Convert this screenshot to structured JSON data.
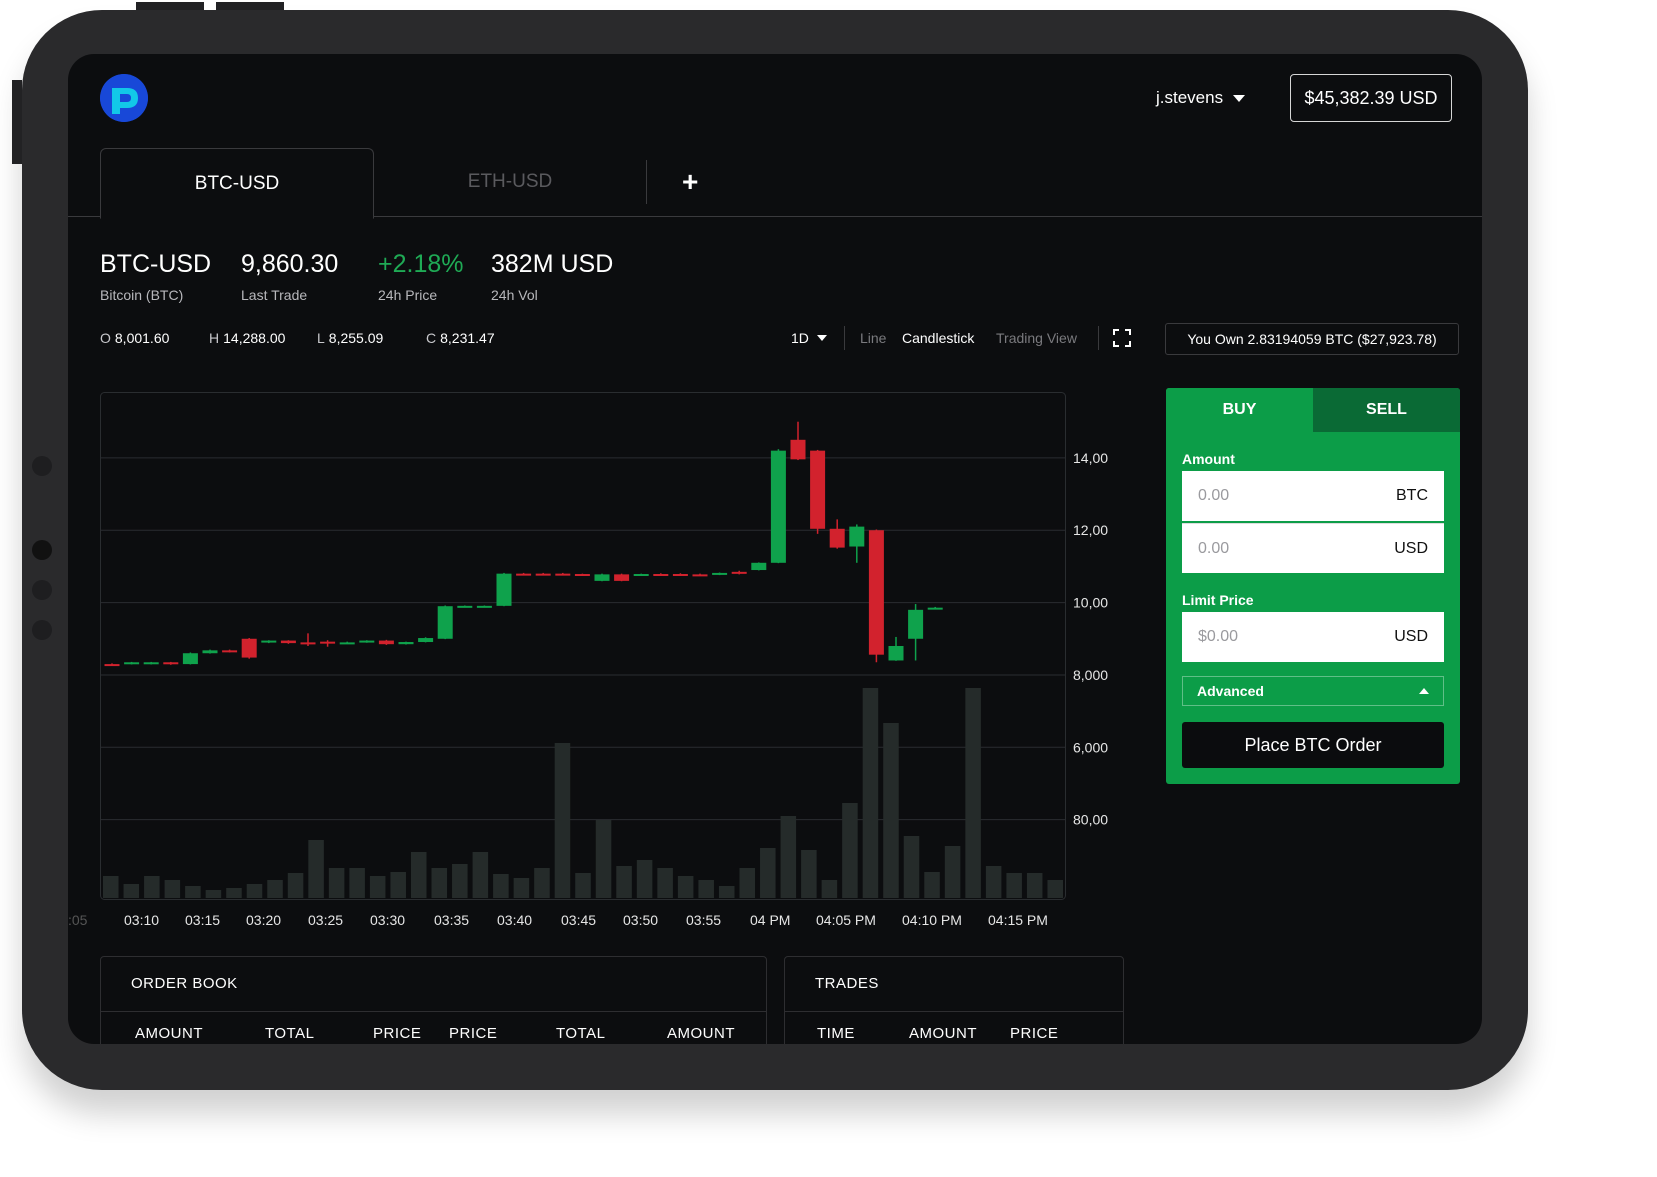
{
  "header": {
    "username": "j.stevens",
    "balance": "$45,382.39 USD"
  },
  "tabs": [
    {
      "label": "BTC-USD",
      "active": true
    },
    {
      "label": "ETH-USD",
      "active": false
    }
  ],
  "add_tab": "+",
  "stats": {
    "pair": "BTC-USD",
    "pair_sub": "Bitcoin (BTC)",
    "last_trade": "9,860.30",
    "last_trade_label": "Last Trade",
    "change": "+2.18%",
    "change_label": "24h Price",
    "volume": "382M USD",
    "volume_label": "24h Vol"
  },
  "ohlc": {
    "o_label": "O",
    "o": "8,001.60",
    "h_label": "H",
    "h": "14,288.00",
    "l_label": "L",
    "l": "8,255.09",
    "c_label": "C",
    "c": "8,231.47"
  },
  "controls": {
    "interval": "1D",
    "line": "Line",
    "candlestick": "Candlestick",
    "trading_view": "Trading View"
  },
  "owned": "You Own 2.83194059 BTC ($27,923.78)",
  "order_panel": {
    "buy": "BUY",
    "sell": "SELL",
    "amount_label": "Amount",
    "amount_btc_placeholder": "0.00",
    "amount_btc_unit": "BTC",
    "amount_usd_placeholder": "0.00",
    "amount_usd_unit": "USD",
    "limit_label": "Limit Price",
    "limit_placeholder": "$0.00",
    "limit_unit": "USD",
    "advanced": "Advanced",
    "place_order": "Place BTC Order"
  },
  "order_book": {
    "title": "ORDER BOOK",
    "columns": [
      "AMOUNT",
      "TOTAL",
      "PRICE",
      "PRICE",
      "TOTAL",
      "AMOUNT"
    ]
  },
  "trades": {
    "title": "TRADES",
    "columns": [
      "TIME",
      "AMOUNT",
      "PRICE"
    ]
  },
  "colors": {
    "up": "#0fa24c",
    "down": "#d2222d",
    "panel": "#0c9d48",
    "volume": "#252b2a"
  },
  "chart_data": {
    "type": "candlestick",
    "y_ticks": [
      "14,000.00",
      "12,000.0",
      "10,000.00",
      "8,000.00",
      "6,000.00",
      "80,000"
    ],
    "ylim": [
      2000,
      15600
    ],
    "x_ticks": [
      ":05",
      "03:10",
      "03:15",
      "03:20",
      "03:25",
      "03:30",
      "03:35",
      "03:40",
      "03:45",
      "03:50",
      "03:55",
      "04 PM",
      "04:05 PM",
      "04:10 PM",
      "04:15 PM"
    ],
    "candles": [
      {
        "o": 8300,
        "h": 8320,
        "l": 8280,
        "c": 8290
      },
      {
        "o": 8300,
        "h": 8360,
        "l": 8290,
        "c": 8350
      },
      {
        "o": 8300,
        "h": 8360,
        "l": 8290,
        "c": 8350
      },
      {
        "o": 8350,
        "h": 8360,
        "l": 8280,
        "c": 8300
      },
      {
        "o": 8300,
        "h": 8620,
        "l": 8290,
        "c": 8600
      },
      {
        "o": 8600,
        "h": 8700,
        "l": 8590,
        "c": 8680
      },
      {
        "o": 8680,
        "h": 8700,
        "l": 8620,
        "c": 8640
      },
      {
        "o": 9000,
        "h": 9020,
        "l": 8450,
        "c": 8480
      },
      {
        "o": 8900,
        "h": 8960,
        "l": 8880,
        "c": 8950
      },
      {
        "o": 8950,
        "h": 8960,
        "l": 8860,
        "c": 8880
      },
      {
        "o": 8900,
        "h": 9150,
        "l": 8800,
        "c": 8880
      },
      {
        "o": 8920,
        "h": 8960,
        "l": 8780,
        "c": 8870
      },
      {
        "o": 8880,
        "h": 8920,
        "l": 8860,
        "c": 8900
      },
      {
        "o": 8900,
        "h": 8960,
        "l": 8890,
        "c": 8950
      },
      {
        "o": 8950,
        "h": 8970,
        "l": 8830,
        "c": 8850
      },
      {
        "o": 8850,
        "h": 8920,
        "l": 8840,
        "c": 8910
      },
      {
        "o": 8910,
        "h": 9040,
        "l": 8900,
        "c": 9020
      },
      {
        "o": 9000,
        "h": 9920,
        "l": 8990,
        "c": 9900
      },
      {
        "o": 9900,
        "h": 9920,
        "l": 9880,
        "c": 9910
      },
      {
        "o": 9900,
        "h": 9920,
        "l": 9880,
        "c": 9910
      },
      {
        "o": 9910,
        "h": 10820,
        "l": 9900,
        "c": 10800
      },
      {
        "o": 10800,
        "h": 10820,
        "l": 10780,
        "c": 10790
      },
      {
        "o": 10800,
        "h": 10820,
        "l": 10780,
        "c": 10790
      },
      {
        "o": 10800,
        "h": 10820,
        "l": 10780,
        "c": 10790
      },
      {
        "o": 10790,
        "h": 10800,
        "l": 10760,
        "c": 10770
      },
      {
        "o": 10600,
        "h": 10800,
        "l": 10590,
        "c": 10780
      },
      {
        "o": 10780,
        "h": 10800,
        "l": 10590,
        "c": 10600
      },
      {
        "o": 10780,
        "h": 10800,
        "l": 10760,
        "c": 10790
      },
      {
        "o": 10790,
        "h": 10810,
        "l": 10770,
        "c": 10780
      },
      {
        "o": 10790,
        "h": 10810,
        "l": 10770,
        "c": 10780
      },
      {
        "o": 10780,
        "h": 10800,
        "l": 10740,
        "c": 10760
      },
      {
        "o": 10770,
        "h": 10830,
        "l": 10760,
        "c": 10820
      },
      {
        "o": 10850,
        "h": 10880,
        "l": 10780,
        "c": 10800
      },
      {
        "o": 10900,
        "h": 11110,
        "l": 10890,
        "c": 11100
      },
      {
        "o": 11100,
        "h": 14240,
        "l": 11090,
        "c": 14200
      },
      {
        "o": 14500,
        "h": 15000,
        "l": 13940,
        "c": 13960
      },
      {
        "o": 14200,
        "h": 14220,
        "l": 11900,
        "c": 12040
      },
      {
        "o": 12040,
        "h": 12300,
        "l": 11490,
        "c": 11520
      },
      {
        "o": 11550,
        "h": 12160,
        "l": 11100,
        "c": 12100
      },
      {
        "o": 12000,
        "h": 12020,
        "l": 8350,
        "c": 8560
      },
      {
        "o": 8400,
        "h": 9050,
        "l": 8390,
        "c": 8800
      },
      {
        "o": 9000,
        "h": 9960,
        "l": 8400,
        "c": 9800
      },
      {
        "o": 9860,
        "h": 9880,
        "l": 9840,
        "c": 9860
      }
    ],
    "volumes": [
      22,
      14,
      22,
      18,
      12,
      8,
      10,
      14,
      18,
      25,
      58,
      30,
      30,
      22,
      26,
      46,
      30,
      34,
      46,
      24,
      20,
      30,
      155,
      25,
      78,
      32,
      38,
      30,
      22,
      18,
      12,
      30,
      50,
      82,
      48,
      18,
      95,
      210,
      175,
      62,
      26,
      52,
      210,
      32,
      25,
      25,
      18
    ]
  }
}
